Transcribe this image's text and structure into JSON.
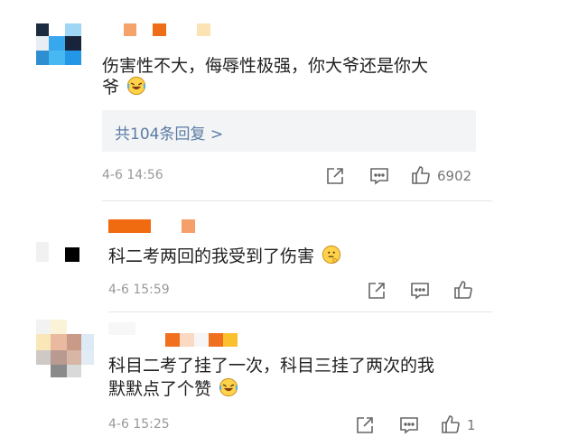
{
  "comments": [
    {
      "text_line1": "伤害性不大，侮辱性极强，你大爷还是你大",
      "text_line2": "爷",
      "emoji": "laughing-crying-emoji",
      "replies_link": "共104条回复 >",
      "time": "4-6 14:56",
      "likes": "6902"
    },
    {
      "text_line1": "科二考两回的我受到了伤害",
      "emoji": "thinking-emoji",
      "time": "4-6 15:59",
      "likes": ""
    },
    {
      "text_line1": "科目二考了挂了一次，科目三挂了两次的我",
      "text_line2": "默默点了个赞",
      "emoji": "laughing-crying-emoji",
      "time": "4-6 15:25",
      "likes": "1"
    }
  ],
  "icons": {
    "share": "share-icon",
    "comment": "comment-icon",
    "like": "thumbs-up-icon"
  },
  "colors": {
    "link": "#5b7ca4",
    "meta": "#999999",
    "reply_bg": "#f3f4f6",
    "name_orange": "#f07020"
  }
}
